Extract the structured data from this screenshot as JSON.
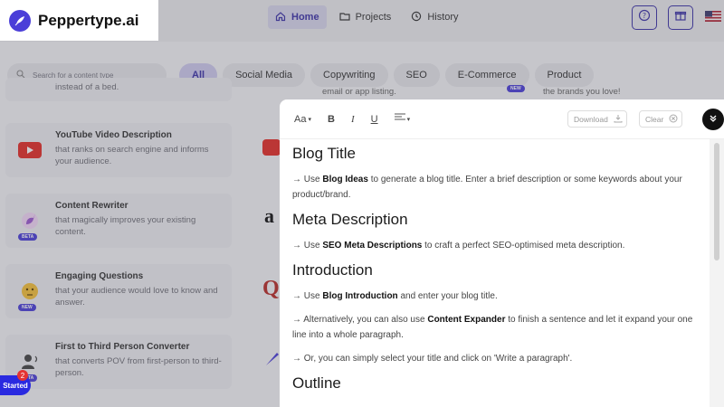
{
  "brand": {
    "name": "Peppertype.ai"
  },
  "nav": {
    "items": [
      {
        "label": "Home",
        "icon": "home-icon",
        "active": true
      },
      {
        "label": "Projects",
        "icon": "folder-icon",
        "active": false
      },
      {
        "label": "History",
        "icon": "clock-icon",
        "active": false
      }
    ],
    "right_icons": [
      "help-icon",
      "gift-icon",
      "us-flag-icon"
    ]
  },
  "filters": {
    "search_placeholder": "Search for a content type",
    "chips": [
      "All",
      "Social Media",
      "Copywriting",
      "SEO",
      "E-Commerce",
      "Product"
    ]
  },
  "cards": [
    {
      "title": "",
      "desc": "instead of a bed."
    },
    {
      "title": "YouTube Video Description",
      "desc": "that ranks on search engine and informs your audience."
    },
    {
      "title": "Content Rewriter",
      "desc": "that magically improves your existing content.",
      "badge": "BETA"
    },
    {
      "title": "Engaging Questions",
      "desc": "that your audience would love to know and answer.",
      "badge": "NEW"
    },
    {
      "title": "First to Third Person Converter",
      "desc": "that converts POV from first-person to third-person.",
      "badge": "BETA"
    }
  ],
  "peeks": {
    "email": "email or app listing.",
    "brands": "the brands you love!",
    "new": "NEW"
  },
  "started": {
    "label": "Started",
    "count": "2"
  },
  "editor": {
    "toolbar": {
      "font_size": "Aa",
      "bold": "B",
      "italic": "I",
      "underline": "U",
      "download": "Download",
      "clear": "Clear"
    },
    "sections": [
      {
        "heading": "Blog Title",
        "paras": [
          [
            "→ Use ",
            "Blog Ideas",
            " to generate a blog title. Enter a brief description or some keywords about your product/brand."
          ]
        ]
      },
      {
        "heading": "Meta Description",
        "paras": [
          [
            "→ Use ",
            "SEO Meta Descriptions",
            " to craft a perfect SEO-optimised meta description."
          ]
        ]
      },
      {
        "heading": "Introduction",
        "paras": [
          [
            "→ Use ",
            "Blog Introduction",
            " and enter your blog title."
          ],
          [
            "→ Alternatively, you can also use ",
            "Content Expander",
            " to finish a sentence and let it expand your one line into a whole paragraph."
          ],
          [
            "→ Or, you can simply select your title and click on 'Write a paragraph'.",
            "",
            ""
          ]
        ]
      },
      {
        "heading": "Outline",
        "paras": []
      }
    ]
  }
}
